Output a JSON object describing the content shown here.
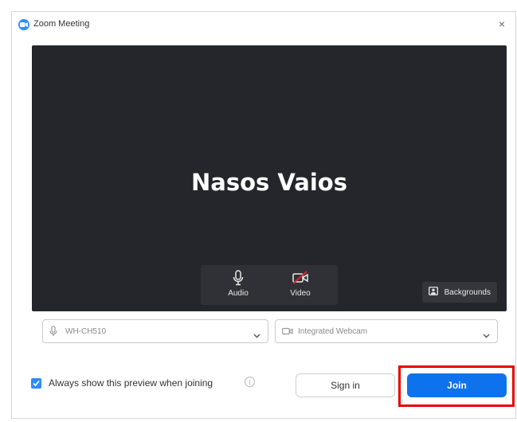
{
  "window": {
    "title": "Zoom Meeting",
    "close_glyph": "×"
  },
  "preview": {
    "display_name": "Nasos Vaios",
    "audio_label": "Audio",
    "video_label": "Video",
    "backgrounds_label": "Backgrounds"
  },
  "devices": {
    "audio_value": "WH-CH510",
    "video_value": "Integrated Webcam"
  },
  "footer": {
    "checkbox_label": "Always show this preview when joining",
    "checkbox_checked": true,
    "info_glyph": "i",
    "signin_label": "Sign in",
    "join_label": "Join"
  },
  "colors": {
    "accent": "#0e72ed",
    "preview_bg": "#24262b",
    "highlight": "#e60000",
    "video_off": "#e02828"
  },
  "icons": [
    "zoom-logo-icon",
    "close-icon",
    "microphone-icon",
    "video-off-icon",
    "backgrounds-icon",
    "chevron-down-icon",
    "camera-icon",
    "checkmark-icon",
    "info-icon"
  ]
}
